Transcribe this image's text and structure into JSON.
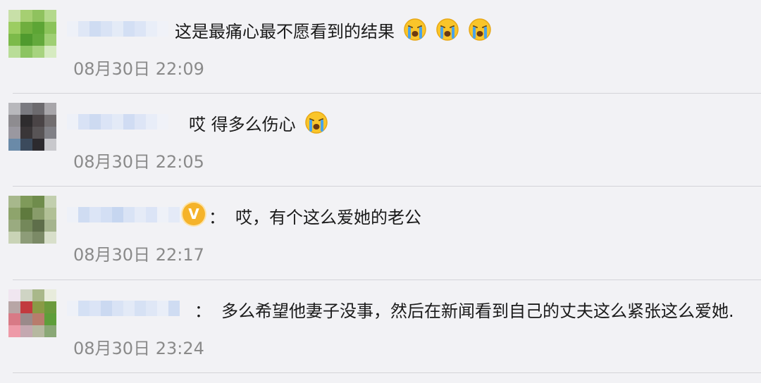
{
  "comments": [
    {
      "text": "这是最痛心最不愿看到的结果",
      "emoji_icon": "crying-face-icon",
      "emoji_count": 3,
      "time": "08月30日 22:09"
    },
    {
      "text": "哎 得多么伤心",
      "emoji_icon": "crying-face-icon",
      "emoji_count": 1,
      "time": "08月30日 22:05"
    },
    {
      "separator": "：",
      "text": "哎，有个这么爱她的老公",
      "badge": "V",
      "time": "08月30日 22:17"
    },
    {
      "separator": "：",
      "text": "多么希望他妻子没事，然后在新闻看到自己的丈夫这么紧张这么爱她.",
      "time": "08月30日 23:24"
    }
  ],
  "colors": {
    "background": "#f2f2f5",
    "text": "#1a1a1a",
    "timestamp": "#8a8a8a",
    "divider": "#d4d4d8",
    "vip_badge": "#f5b32a"
  }
}
